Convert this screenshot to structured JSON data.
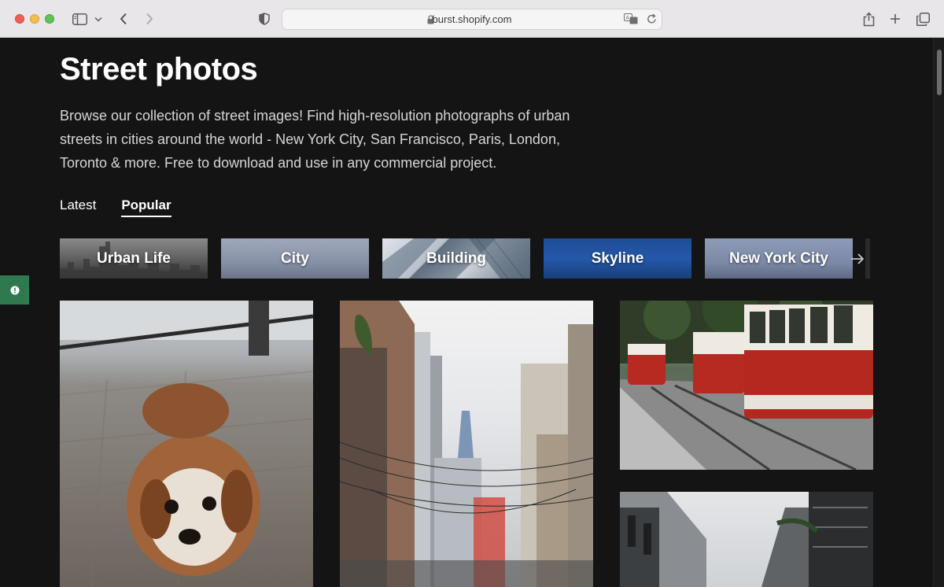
{
  "browser": {
    "url": "burst.shopify.com"
  },
  "page": {
    "title": "Street photos",
    "description": "Browse our collection of street images! Find high-resolution photographs of urban streets in cities around the world - New York City, San Francisco, Paris, London, Toronto & more. Free to download and use in any commercial project."
  },
  "tabs": [
    {
      "label": "Latest",
      "active": false
    },
    {
      "label": "Popular",
      "active": true
    }
  ],
  "categories": [
    {
      "label": "Urban Life"
    },
    {
      "label": "City"
    },
    {
      "label": "Building"
    },
    {
      "label": "Skyline"
    },
    {
      "label": "New York City"
    }
  ],
  "photos": [
    {
      "subject": "dog on brick sidewalk"
    },
    {
      "subject": "narrow city street with tall buildings"
    },
    {
      "subject": "red and white trams"
    },
    {
      "subject": "street with apartment buildings"
    }
  ],
  "colors": {
    "background": "#141414",
    "feedback": "#2e7a4e"
  }
}
